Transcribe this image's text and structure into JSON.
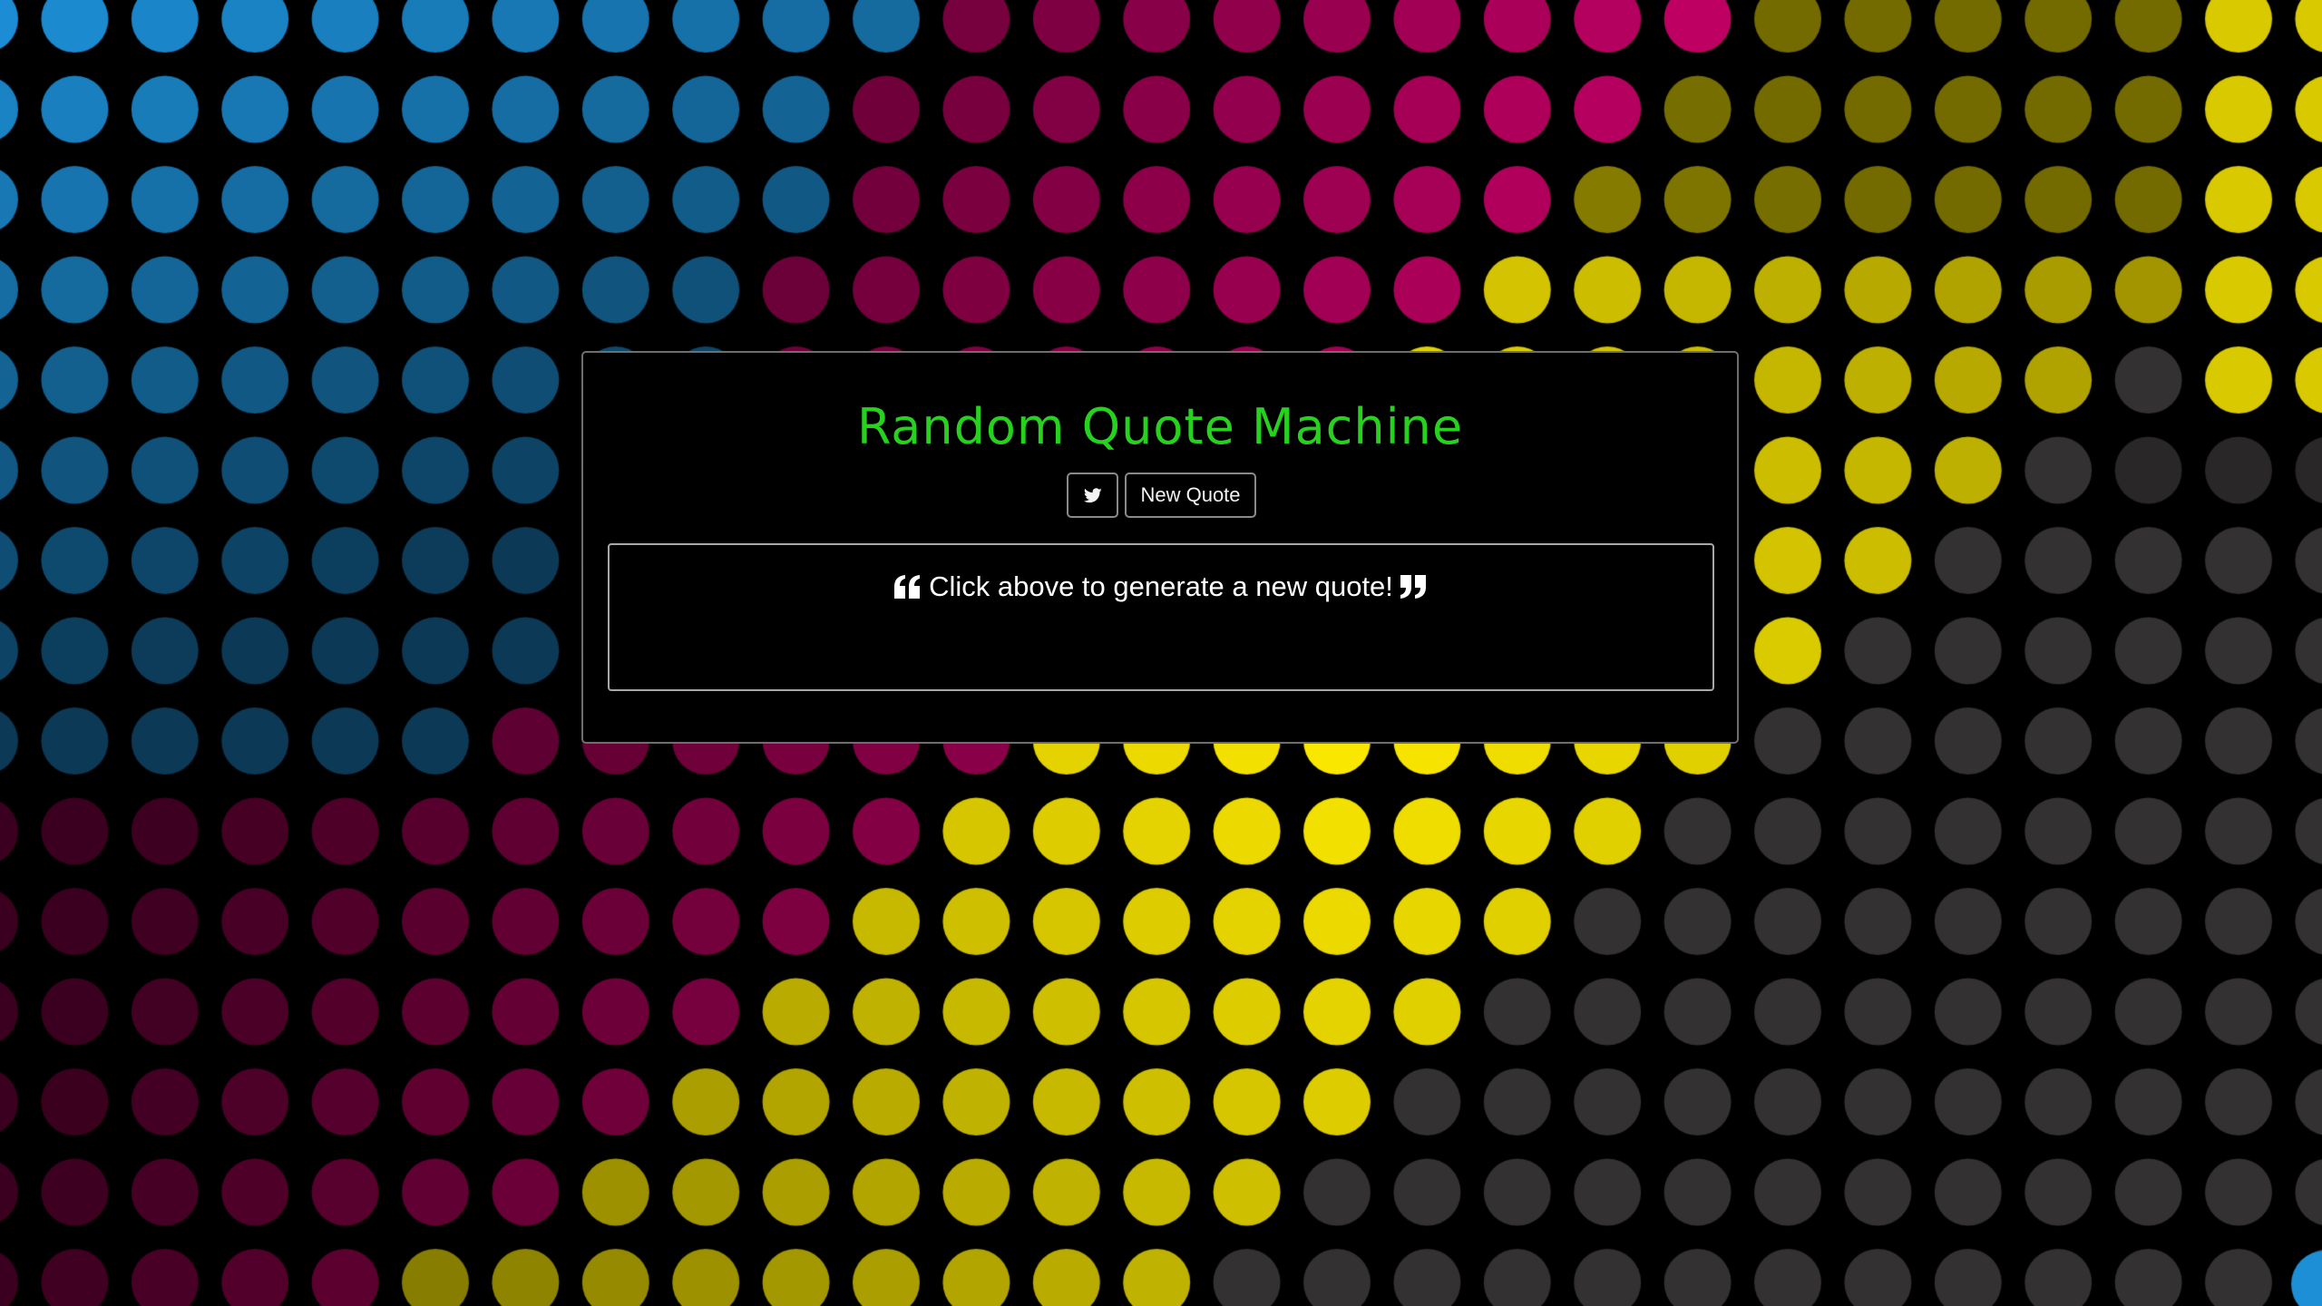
{
  "app": {
    "title": "Random Quote Machine"
  },
  "toolbar": {
    "twitter_icon": "twitter-icon",
    "new_quote_label": "New Quote"
  },
  "quote": {
    "text": "Click above to generate a new quote!",
    "open_icon": "quote-left-icon",
    "close_icon": "quote-right-icon"
  },
  "colors": {
    "title": "#27d21f",
    "panel_background": "#000000",
    "background_blue": "#1c8fd6",
    "background_magenta": "#c40066",
    "background_yellow": "#ffec00",
    "background_gray": "#4a4648"
  }
}
